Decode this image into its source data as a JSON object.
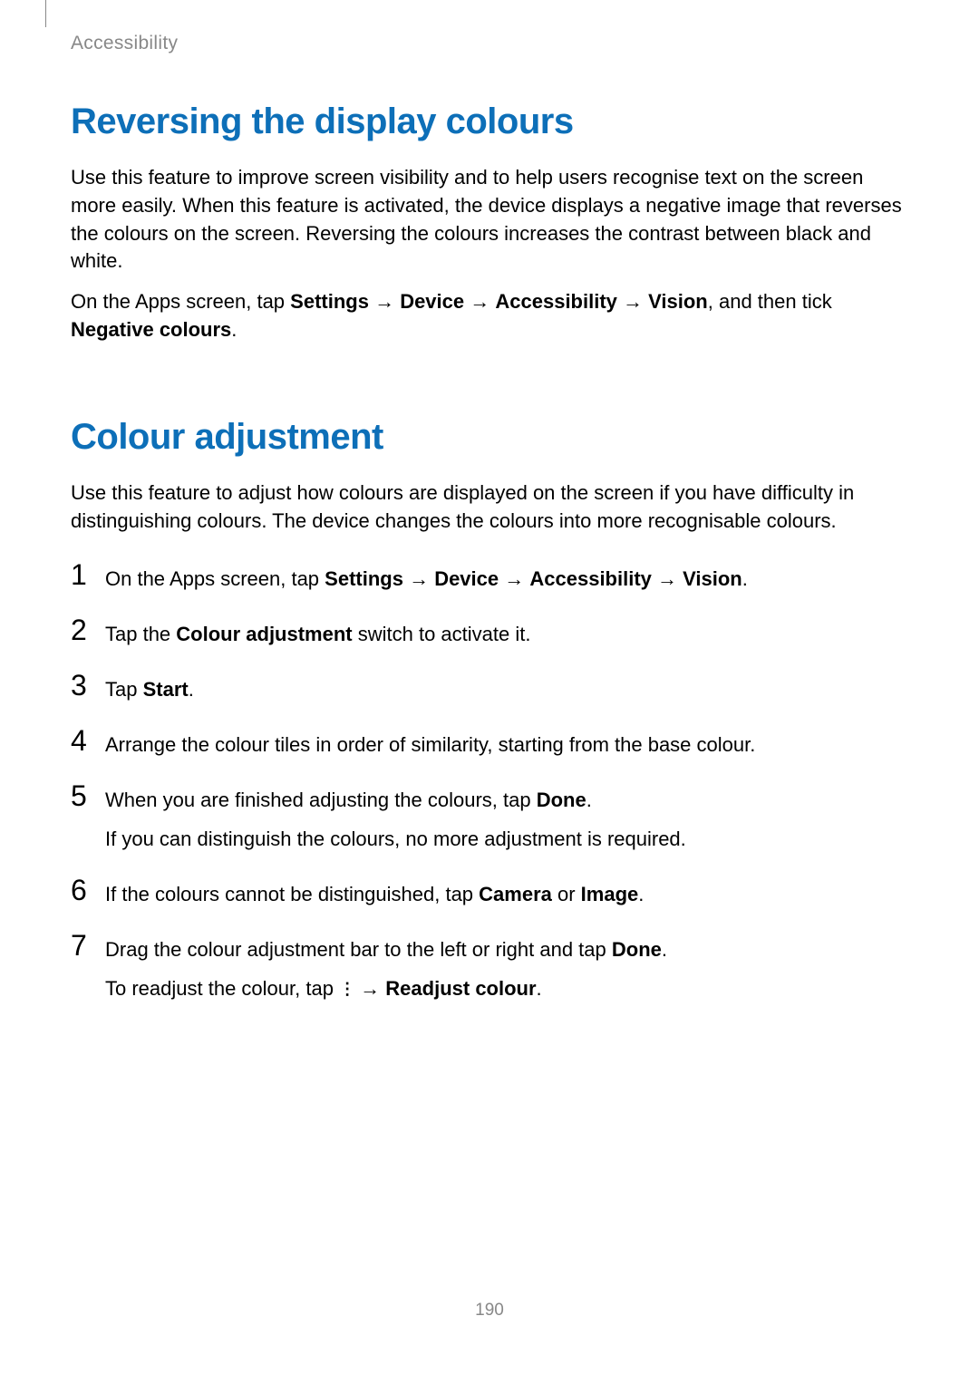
{
  "header": "Accessibility",
  "page_number": "190",
  "section1": {
    "title": "Reversing the display colours",
    "para1": "Use this feature to improve screen visibility and to help users recognise text on the screen more easily. When this feature is activated, the device displays a negative image that reverses the colours on the screen. Reversing the colours increases the contrast between black and white.",
    "para2_pre": "On the Apps screen, tap ",
    "para2_b_settings": "Settings",
    "para2_arr1": " → ",
    "para2_b_device": "Device",
    "para2_arr2": " → ",
    "para2_b_accessibility": "Accessibility",
    "para2_arr3": " → ",
    "para2_b_vision": "Vision",
    "para2_mid": ", and then tick ",
    "para2_b_negative": "Negative colours",
    "para2_end": "."
  },
  "section2": {
    "title": "Colour adjustment",
    "para1": "Use this feature to adjust how colours are displayed on the screen if you have difficulty in distinguishing colours. The device changes the colours into more recognisable colours.",
    "step1_pre": "On the Apps screen, tap ",
    "step1_b_settings": "Settings",
    "step1_arr1": " → ",
    "step1_b_device": "Device",
    "step1_arr2": " → ",
    "step1_b_accessibility": "Accessibility",
    "step1_arr3": " → ",
    "step1_b_vision": "Vision",
    "step1_end": ".",
    "step2_pre": "Tap the ",
    "step2_b": "Colour adjustment",
    "step2_post": " switch to activate it.",
    "step3_pre": "Tap ",
    "step3_b": "Start",
    "step3_post": ".",
    "step4": "Arrange the colour tiles in order of similarity, starting from the base colour.",
    "step5_pre": "When you are finished adjusting the colours, tap ",
    "step5_b": "Done",
    "step5_post": ".",
    "step5_sub": "If you can distinguish the colours, no more adjustment is required.",
    "step6_pre": "If the colours cannot be distinguished, tap ",
    "step6_b1": "Camera",
    "step6_mid": " or ",
    "step6_b2": "Image",
    "step6_post": ".",
    "step7_pre": "Drag the colour adjustment bar to the left or right and tap ",
    "step7_b1": "Done",
    "step7_post1": ".",
    "step7_sub_pre": "To readjust the colour, tap ",
    "step7_sub_arr": " → ",
    "step7_sub_b": "Readjust colour",
    "step7_sub_post": "."
  },
  "nums": {
    "n1": "1",
    "n2": "2",
    "n3": "3",
    "n4": "4",
    "n5": "5",
    "n6": "6",
    "n7": "7"
  }
}
